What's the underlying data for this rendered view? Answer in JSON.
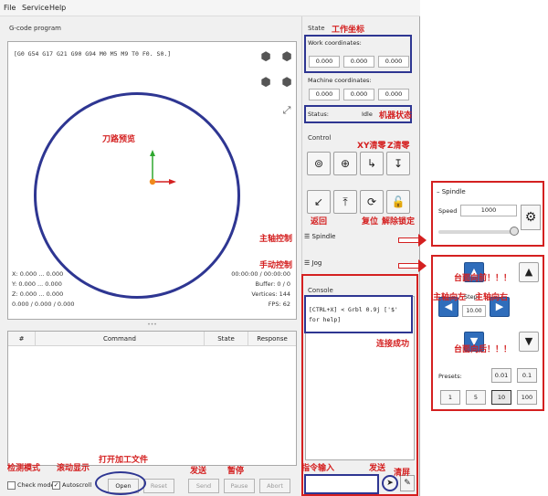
{
  "menu": {
    "items": [
      "File",
      "Service",
      "Help"
    ]
  },
  "gcode": {
    "title": "G-code program",
    "line": "[G0 G54 G17 G21 G90 G94 M0 M5 M9 T0 F0. S0.]",
    "stats_left": [
      "X: 0.000 ... 0.000",
      "Y: 0.000 ... 0.000",
      "Z: 0.000 ... 0.000",
      "0.000 / 0.000 / 0.000"
    ],
    "stats_right": [
      "00:00:00 / 00:00:00",
      "Buffer: 0 / 0",
      "Vertices: 144",
      "FPS: 62"
    ]
  },
  "table": {
    "headers": [
      "#",
      "Command",
      "State",
      "Response"
    ]
  },
  "bottom": {
    "check_mode_label": "Check mode",
    "autoscroll_label": "Autoscroll",
    "autoscroll_checked": true,
    "buttons": [
      "Open",
      "Reset",
      "Send",
      "Pause",
      "Abort"
    ]
  },
  "state": {
    "title": "State",
    "work_label": "Work coordinates:",
    "work_values": [
      "0.000",
      "0.000",
      "0.000"
    ],
    "machine_label": "Machine coordinates:",
    "machine_values": [
      "0.000",
      "0.000",
      "0.000"
    ],
    "status_label": "Status:",
    "status_value": "Idle"
  },
  "control": {
    "title": "Control"
  },
  "spindle_row": {
    "label": "Spindle"
  },
  "jog_row": {
    "label": "Jog"
  },
  "console": {
    "title": "Console",
    "text": "[CTRL+X] < Grbl 0.9j ['$' for help]"
  },
  "spindle_panel": {
    "title": "Spindle",
    "speed_label": "Speed",
    "speed_value": "1000",
    "slider_fraction": 0.97
  },
  "jog_panel": {
    "step_label": "Step:",
    "step_value": "10.00",
    "presets_label": "Presets:",
    "preset_row1": [
      "0.01",
      "0.1"
    ],
    "preset_row2": [
      "1",
      "5",
      "10",
      "100"
    ],
    "selected_preset": "10"
  },
  "annotations": {
    "work_coords": "工作坐标",
    "machine_state": "机器状态",
    "toolpath_preview": "刀路预览",
    "xy_zero": "XY清零",
    "z_zero": "Z清零",
    "return": "返回",
    "reset": "复位",
    "unlock": "解除锁定",
    "spindle_control": "主轴控制",
    "manual_control": "手动控制",
    "connected": "连接成功",
    "command_input": "指令输入",
    "send_cmd": "发送",
    "clear_screen": "清屏",
    "check_mode": "检测模式",
    "autoscroll": "滚动显示",
    "open_file": "打开加工文件",
    "send": "发送",
    "pause": "暂停",
    "table_forward": "台面向前！！！",
    "table_backward": "台面向后！！！",
    "spindle_left": "主轴向左",
    "spindle_right": "主轴向右"
  }
}
